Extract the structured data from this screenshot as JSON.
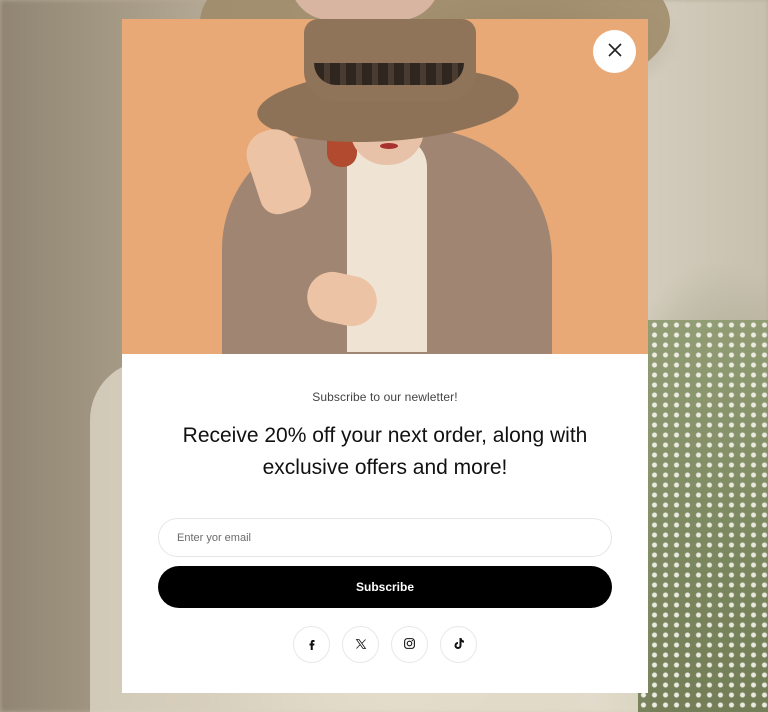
{
  "popup": {
    "eyebrow": "Subscribe to our newletter!",
    "headline": "Receive 20% off your next order, along with exclusive offers and more!",
    "email_placeholder": "Enter yor email",
    "subscribe_label": "Subscribe",
    "close_icon": "close-icon"
  },
  "socials": [
    {
      "icon": "facebook-icon"
    },
    {
      "icon": "x-twitter-icon"
    },
    {
      "icon": "instagram-icon"
    },
    {
      "icon": "tiktok-icon"
    }
  ],
  "colors": {
    "hero_background": "#e8a977",
    "button_background": "#000000",
    "button_text": "#ffffff"
  }
}
